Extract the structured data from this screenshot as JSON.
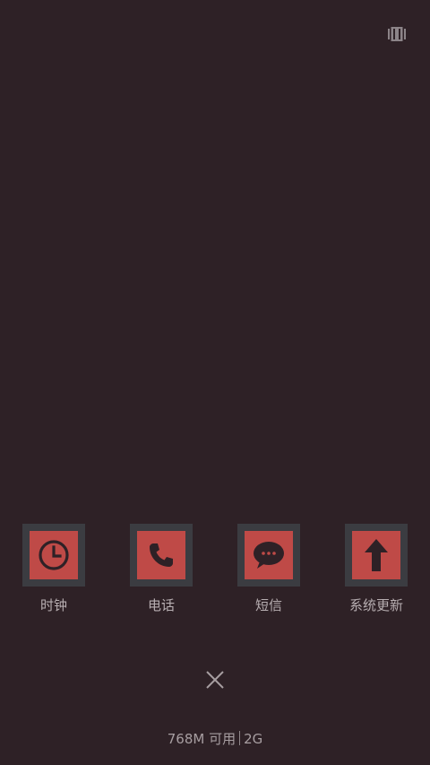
{
  "icons": {
    "top_action": "card-stack-icon",
    "close": "close-icon"
  },
  "apps": [
    {
      "label": "时钟",
      "icon": "clock-icon"
    },
    {
      "label": "电话",
      "icon": "phone-icon"
    },
    {
      "label": "短信",
      "icon": "message-icon"
    },
    {
      "label": "系统更新",
      "icon": "up-arrow-icon"
    }
  ],
  "memory": {
    "available": "768M 可用",
    "total": "2G"
  },
  "colors": {
    "background": "#2e2126",
    "tile_frame": "#3b3c41",
    "tile_fill": "#bf4a47",
    "label_text": "#b7aeb1"
  }
}
